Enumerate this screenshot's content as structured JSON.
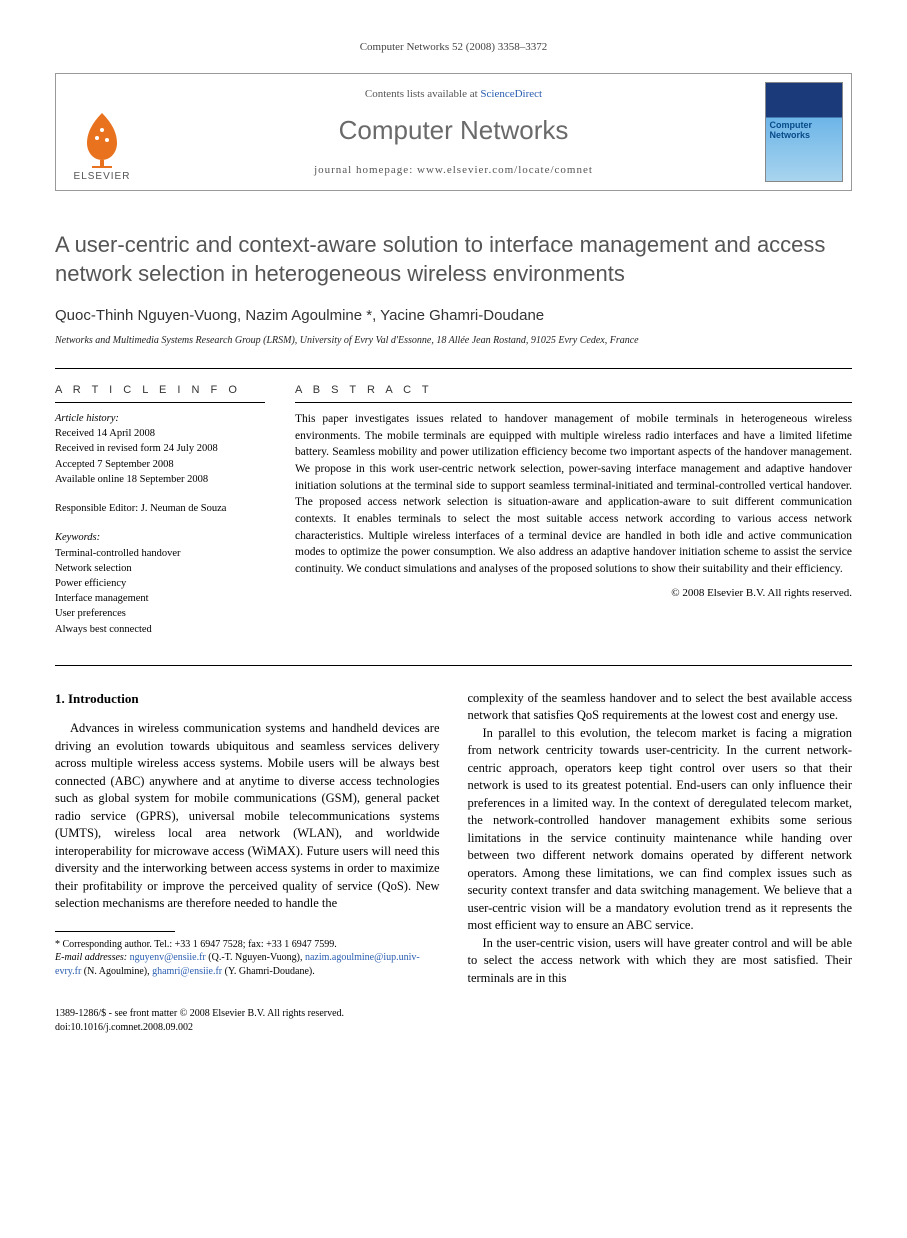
{
  "header": {
    "citation": "Computer Networks 52 (2008) 3358–3372"
  },
  "banner": {
    "contents_prefix": "Contents lists available at ",
    "contents_link": "ScienceDirect",
    "journal_name": "Computer Networks",
    "homepage_label": "journal homepage: www.elsevier.com/locate/comnet",
    "publisher_name": "ELSEVIER",
    "cover_title": "Computer Networks"
  },
  "article": {
    "title": "A user-centric and context-aware solution to interface management and access network selection in heterogeneous wireless environments",
    "authors": "Quoc-Thinh Nguyen-Vuong, Nazim Agoulmine *, Yacine Ghamri-Doudane",
    "affiliation": "Networks and Multimedia Systems Research Group (LRSM), University of Evry Val d'Essonne, 18 Allée Jean Rostand, 91025 Evry Cedex, France"
  },
  "info": {
    "heading": "A R T I C L E   I N F O",
    "history_label": "Article history:",
    "received": "Received 14 April 2008",
    "revised": "Received in revised form 24 July 2008",
    "accepted": "Accepted 7 September 2008",
    "online": "Available online 18 September 2008",
    "editor": "Responsible Editor: J. Neuman de Souza",
    "keywords_label": "Keywords:",
    "keywords": [
      "Terminal-controlled handover",
      "Network selection",
      "Power efficiency",
      "Interface management",
      "User preferences",
      "Always best connected"
    ]
  },
  "abstract": {
    "heading": "A B S T R A C T",
    "text": "This paper investigates issues related to handover management of mobile terminals in heterogeneous wireless environments. The mobile terminals are equipped with multiple wireless radio interfaces and have a limited lifetime battery. Seamless mobility and power utilization efficiency become two important aspects of the handover management. We propose in this work user-centric network selection, power-saving interface management and adaptive handover initiation solutions at the terminal side to support seamless terminal-initiated and terminal-controlled vertical handover. The proposed access network selection is situation-aware and application-aware to suit different communication contexts. It enables terminals to select the most suitable access network according to various access network characteristics. Multiple wireless interfaces of a terminal device are handled in both idle and active communication modes to optimize the power consumption. We also address an adaptive handover initiation scheme to assist the service continuity. We conduct simulations and analyses of the proposed solutions to show their suitability and their efficiency.",
    "copyright": "© 2008 Elsevier B.V. All rights reserved."
  },
  "body": {
    "section_heading": "1. Introduction",
    "p1": "Advances in wireless communication systems and handheld devices are driving an evolution towards ubiquitous and seamless services delivery across multiple wireless access systems. Mobile users will be always best connected (ABC) anywhere and at anytime to diverse access technologies such as global system for mobile communications (GSM), general packet radio service (GPRS), universal mobile telecommunications systems (UMTS), wireless local area network (WLAN), and worldwide interoperability for microwave access (WiMAX). Future users will need this diversity and the interworking between access systems in order to maximize their profitability or improve the perceived quality of service (QoS). New selection mechanisms are therefore needed to handle the",
    "p2": "complexity of the seamless handover and to select the best available access network that satisfies QoS requirements at the lowest cost and energy use.",
    "p3": "In parallel to this evolution, the telecom market is facing a migration from network centricity towards user-centricity. In the current network-centric approach, operators keep tight control over users so that their network is used to its greatest potential. End-users can only influence their preferences in a limited way. In the context of deregulated telecom market, the network-controlled handover management exhibits some serious limitations in the service continuity maintenance while handing over between two different network domains operated by different network operators. Among these limitations, we can find complex issues such as security context transfer and data switching management. We believe that a user-centric vision will be a mandatory evolution trend as it represents the most efficient way to ensure an ABC service.",
    "p4": "In the user-centric vision, users will have greater control and will be able to select the access network with which they are most satisfied. Their terminals are in this"
  },
  "footnote": {
    "corr": "* Corresponding author. Tel.: +33 1 6947 7528; fax: +33 1 6947 7599.",
    "emails_label": "E-mail addresses:",
    "e1": "nguyenv@ensiie.fr",
    "e1_who": "(Q.-T. Nguyen-Vuong),",
    "e2": "nazim.agoulmine@iup.univ-evry.fr",
    "e2_who": "(N. Agoulmine),",
    "e3": "ghamri@ensiie.fr",
    "e3_who": "(Y. Ghamri-Doudane)."
  },
  "bottom": {
    "line1": "1389-1286/$ - see front matter © 2008 Elsevier B.V. All rights reserved.",
    "line2": "doi:10.1016/j.comnet.2008.09.002"
  }
}
